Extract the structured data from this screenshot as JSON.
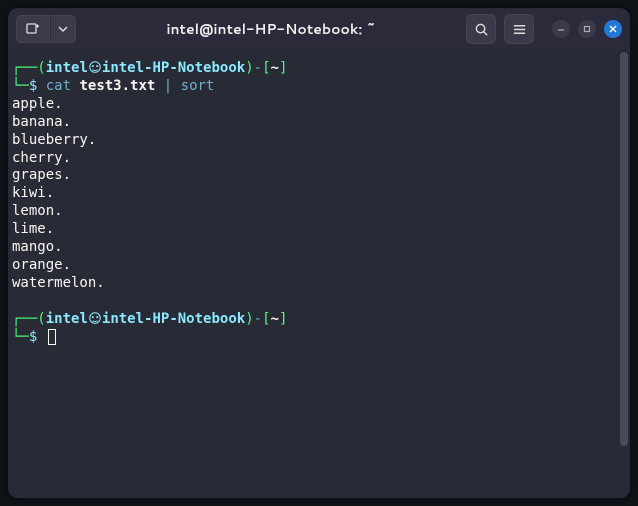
{
  "titlebar": {
    "title": "intel@intel-HP-Notebook: ~"
  },
  "prompt": {
    "user": "intel",
    "host": "intel-HP-Notebook",
    "cwd": "~",
    "symbol": "$"
  },
  "command": {
    "cat": "cat",
    "file": "test3.txt",
    "pipe": "|",
    "sort": "sort"
  },
  "output": [
    "apple.",
    "banana.",
    "blueberry.",
    "cherry.",
    "grapes.",
    "kiwi.",
    "lemon.",
    "lime.",
    "mango.",
    "orange.",
    "watermelon."
  ]
}
